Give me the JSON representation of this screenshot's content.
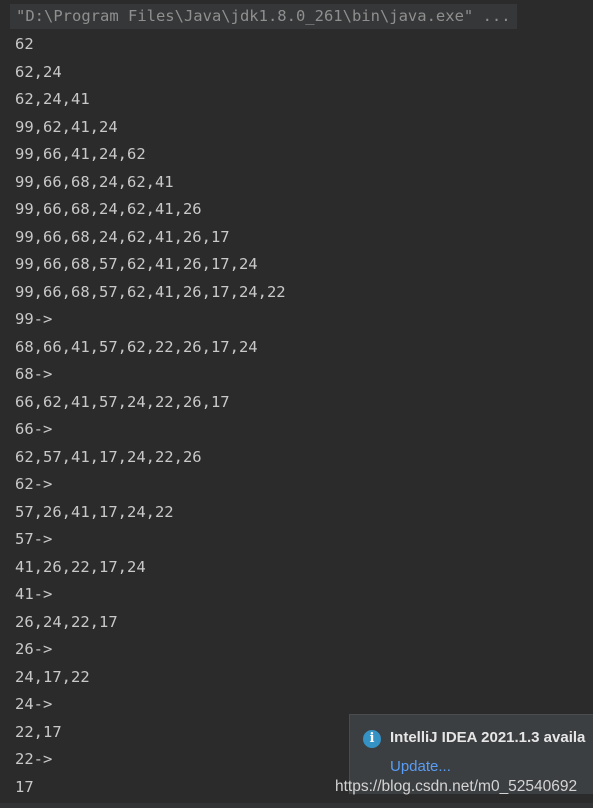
{
  "console": {
    "command": "\"D:\\Program Files\\Java\\jdk1.8.0_261\\bin\\java.exe\" ...",
    "lines": [
      "62",
      "62,24",
      "62,24,41",
      "99,62,41,24",
      "99,66,41,24,62",
      "99,66,68,24,62,41",
      "99,66,68,24,62,41,26",
      "99,66,68,24,62,41,26,17",
      "99,66,68,57,62,41,26,17,24",
      "99,66,68,57,62,41,26,17,24,22",
      "99->",
      "68,66,41,57,62,22,26,17,24",
      "68->",
      "66,62,41,57,24,22,26,17",
      "66->",
      "62,57,41,17,24,22,26",
      "62->",
      "57,26,41,17,24,22",
      "57->",
      "41,26,22,17,24",
      "41->",
      "26,24,22,17",
      "26->",
      "24,17,22",
      "24->",
      "22,17",
      "22->",
      "17"
    ]
  },
  "notification": {
    "icon": "info-icon",
    "icon_glyph": "i",
    "title": "IntelliJ IDEA 2021.1.3 availa",
    "link": "Update..."
  },
  "watermark": "https://blog.csdn.net/m0_52540692",
  "colors": {
    "background": "#2b2b2b",
    "text": "#c9c9c9",
    "command_text": "#8f8f8f",
    "link": "#589df6",
    "info_icon": "#3592c4"
  }
}
